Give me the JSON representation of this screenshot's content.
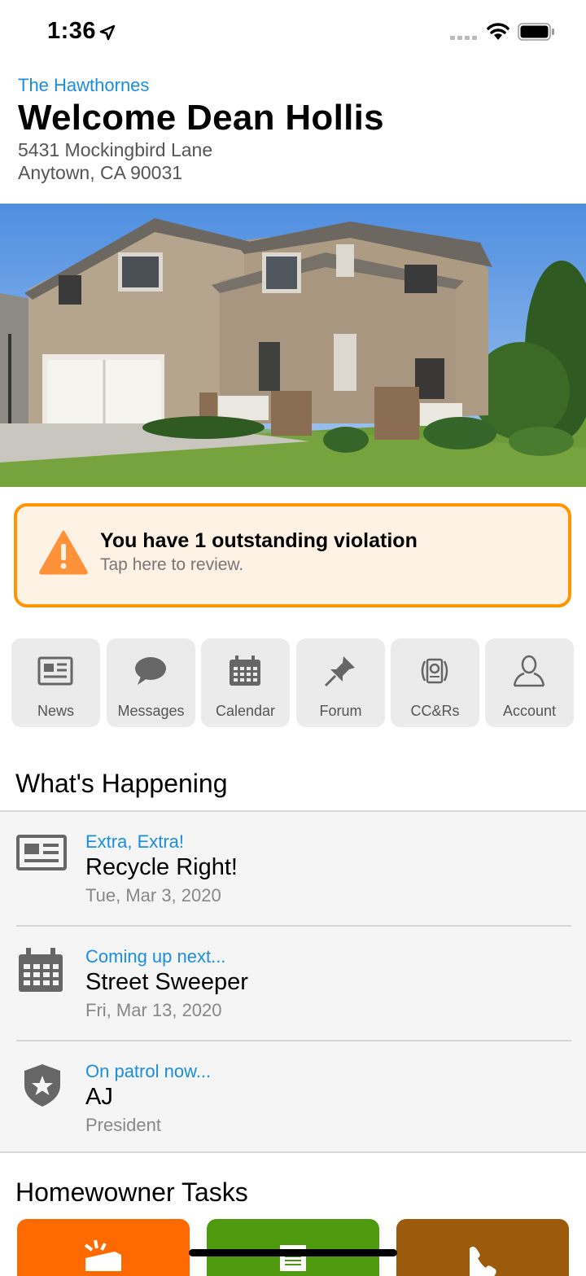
{
  "status_bar": {
    "time": "1:36"
  },
  "header": {
    "community": "The Hawthornes",
    "welcome": "Welcome Dean Hollis",
    "address_line1": "5431 Mockingbird Lane",
    "address_line2": "Anytown, CA 90031"
  },
  "violation": {
    "title": "You have 1 outstanding violation",
    "subtitle": "Tap here to review."
  },
  "quick_links": [
    {
      "label": "News",
      "icon": "newspaper-icon"
    },
    {
      "label": "Messages",
      "icon": "speech-bubble-icon"
    },
    {
      "label": "Calendar",
      "icon": "calendar-icon"
    },
    {
      "label": "Forum",
      "icon": "pushpin-icon"
    },
    {
      "label": "CC&Rs",
      "icon": "certificate-icon"
    },
    {
      "label": "Account",
      "icon": "person-icon"
    }
  ],
  "happening": {
    "title": "What's Happening",
    "items": [
      {
        "kicker": "Extra, Extra!",
        "title": "Recycle Right!",
        "subtitle": "Tue, Mar 3, 2020",
        "icon": "newspaper-icon"
      },
      {
        "kicker": "Coming up next...",
        "title": "Street Sweeper",
        "subtitle": "Fri, Mar 13, 2020",
        "icon": "calendar-icon"
      },
      {
        "kicker": "On patrol now...",
        "title": "AJ",
        "subtitle": "President",
        "icon": "shield-star-icon"
      }
    ]
  },
  "tasks": {
    "title": "Homewowner Tasks",
    "tiles": [
      {
        "color": "#ff6a00",
        "icon": "whistle-icon"
      },
      {
        "color": "#4f9a0e",
        "icon": "document-icon"
      },
      {
        "color": "#9b5a0c",
        "icon": "phone-icon"
      }
    ]
  },
  "colors": {
    "accent": "#1a8ee0",
    "warning": "#ff9500",
    "warning_bg": "#fef2e4"
  }
}
